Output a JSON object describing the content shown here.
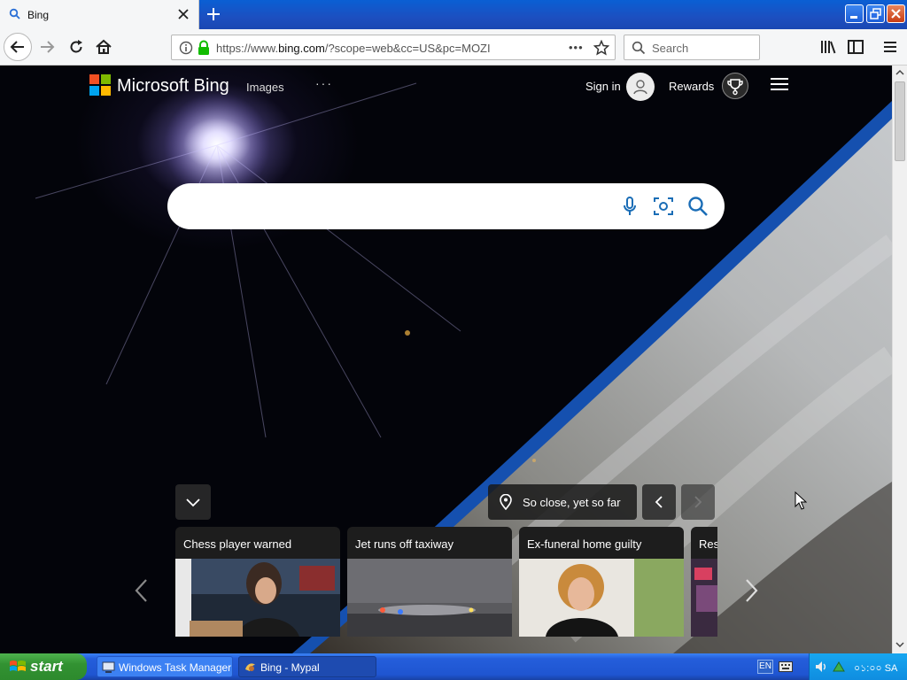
{
  "browser": {
    "tab_title": "Bing",
    "new_tab_label": "+",
    "url_prefix": "https://www.",
    "url_domain": "bing.com",
    "url_path": "/?scope=web&cc=US&pc=MOZI",
    "page_actions": "•••",
    "search_placeholder": "Search"
  },
  "bing": {
    "logo_text": "Microsoft Bing",
    "nav_images": "Images",
    "nav_more": "···",
    "signin": "Sign in",
    "rewards": "Rewards",
    "location": "So close, yet so far",
    "search_value": ""
  },
  "news": [
    {
      "title": "Chess player warned"
    },
    {
      "title": "Jet runs off taxiway"
    },
    {
      "title": "Ex-funeral home guilty"
    },
    {
      "title": "Res"
    }
  ],
  "taskbar": {
    "start": "start",
    "tasks": [
      {
        "label": "Windows Task Manager"
      },
      {
        "label": "Bing - Mypal"
      }
    ],
    "lang": "EN",
    "clock": "০১:০০ SA"
  },
  "colors": {
    "logo_red": "#f25022",
    "logo_green": "#7fba00",
    "logo_blue": "#00a4ef",
    "logo_yellow": "#ffb900",
    "bing_accent": "#1a6db6",
    "xp_blue": "#245edb",
    "start_green": "#329232"
  }
}
